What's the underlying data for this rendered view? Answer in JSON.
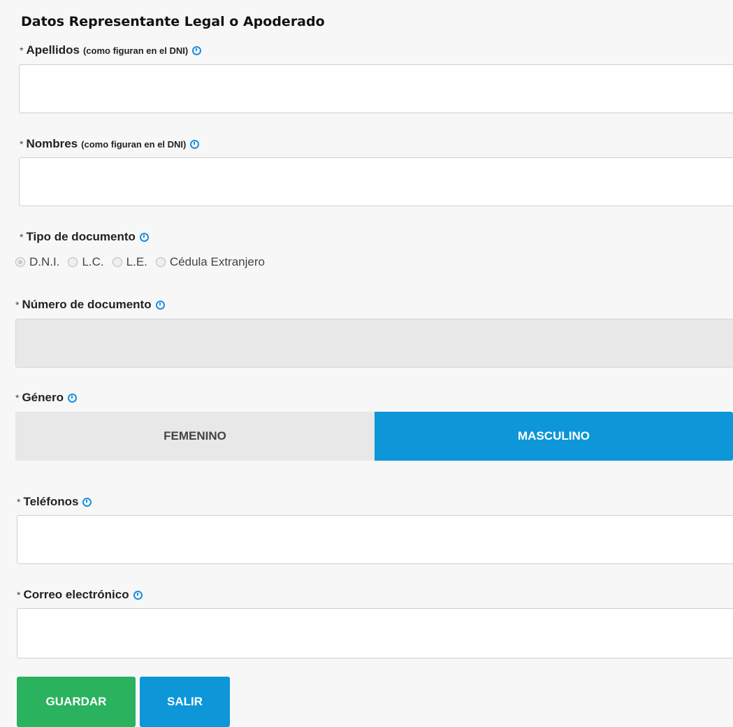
{
  "section_title": "Datos Representante Legal o Apoderado",
  "required_mark": "*",
  "fields": {
    "apellidos": {
      "label": "Apellidos",
      "hint": "(como figuran en el DNI)",
      "value": ""
    },
    "nombres": {
      "label": "Nombres",
      "hint": "(como figuran en el DNI)",
      "value": ""
    },
    "tipo_documento": {
      "label": "Tipo de documento",
      "options": [
        "D.N.I.",
        "L.C.",
        "L.E.",
        "Cédula Extranjero"
      ],
      "selected": "D.N.I."
    },
    "numero_documento": {
      "label": "Número de documento",
      "value": ""
    },
    "genero": {
      "label": "Género",
      "options": [
        "FEMENINO",
        "MASCULINO"
      ],
      "selected": "MASCULINO"
    },
    "telefonos": {
      "label": "Teléfonos",
      "value": ""
    },
    "correo": {
      "label": "Correo electrónico",
      "value": ""
    }
  },
  "buttons": {
    "save": "GUARDAR",
    "exit": "SALIR"
  },
  "colors": {
    "accent": "#0d96d8",
    "save": "#2ab25e",
    "info_icon": "#1a8fe0"
  },
  "icons": {
    "info": "clock-info-icon"
  }
}
